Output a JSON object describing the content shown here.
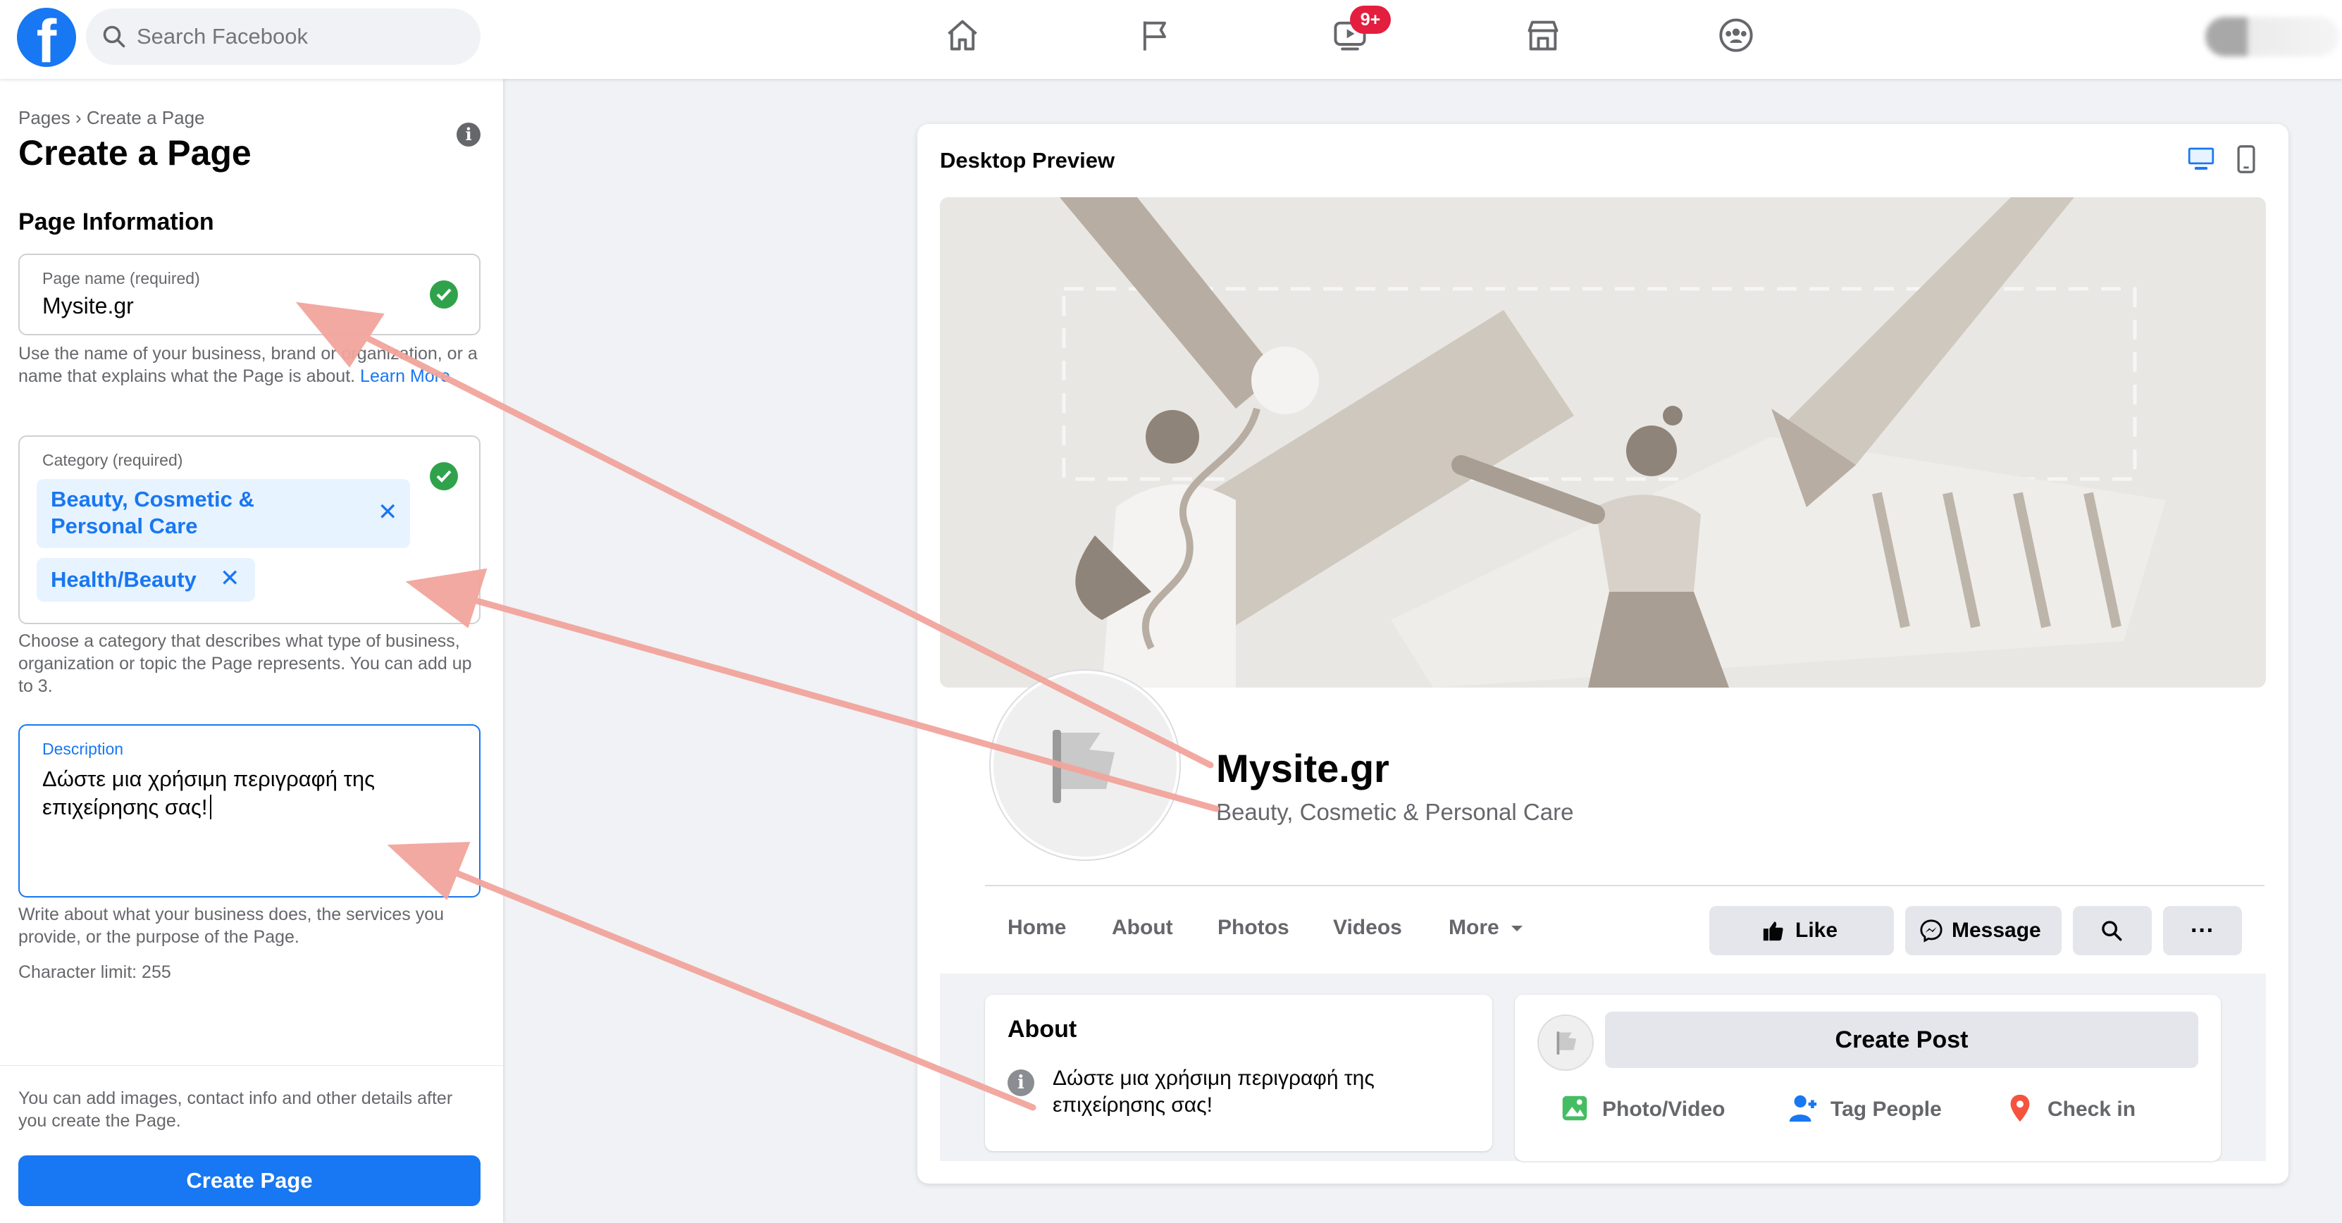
{
  "topbar": {
    "search_placeholder": "Search Facebook",
    "watch_badge": "9+",
    "logo": "f",
    "icons": [
      "home-icon",
      "flag-icon",
      "watch-icon",
      "marketplace-icon",
      "groups-icon"
    ]
  },
  "sidebar": {
    "breadcrumb": "Pages › Create a Page",
    "title": "Create a Page",
    "info_glyph": "i",
    "section": "Page Information",
    "page_name": {
      "label": "Page name (required)",
      "value": "Mysite.gr",
      "help": "Use the name of your business, brand or organization, or a name that explains what the Page is about.",
      "help_link": "Learn More"
    },
    "category": {
      "label": "Category (required)",
      "chips": [
        "Beauty, Cosmetic & Personal Care",
        "Health/Beauty"
      ],
      "remove_glyph": "✕",
      "help": "Choose a category that describes what type of business, organization or topic the Page represents. You can add up to 3."
    },
    "description": {
      "label": "Description",
      "value": "Δώστε μια χρήσιμη περιγραφή της επιχείρησης σας!",
      "help": "Write about what your business does, the services you provide, or the purpose of the Page.",
      "limit": "Character limit: 255"
    },
    "footer_note": "You can add images, contact info and other details after you create the Page.",
    "create_button": "Create Page"
  },
  "preview": {
    "title": "Desktop Preview",
    "page_name": "Mysite.gr",
    "category": "Beauty, Cosmetic & Personal Care",
    "tabs": [
      "Home",
      "About",
      "Photos",
      "Videos",
      "More"
    ],
    "buttons": {
      "like": "Like",
      "message": "Message",
      "more": "···"
    },
    "about_title": "About",
    "about_glyph": "i",
    "about_text": "Δώστε μια χρήσιμη περιγραφή της επιχείρησης σας!",
    "create_post": "Create Post",
    "actions": [
      "Photo/Video",
      "Tag People",
      "Check in"
    ]
  },
  "colors": {
    "accent": "#1877f2",
    "success": "#31a24c",
    "badge": "#e41e3f",
    "chip_bg": "#e7f3ff",
    "arrow": "#f2a59c"
  }
}
